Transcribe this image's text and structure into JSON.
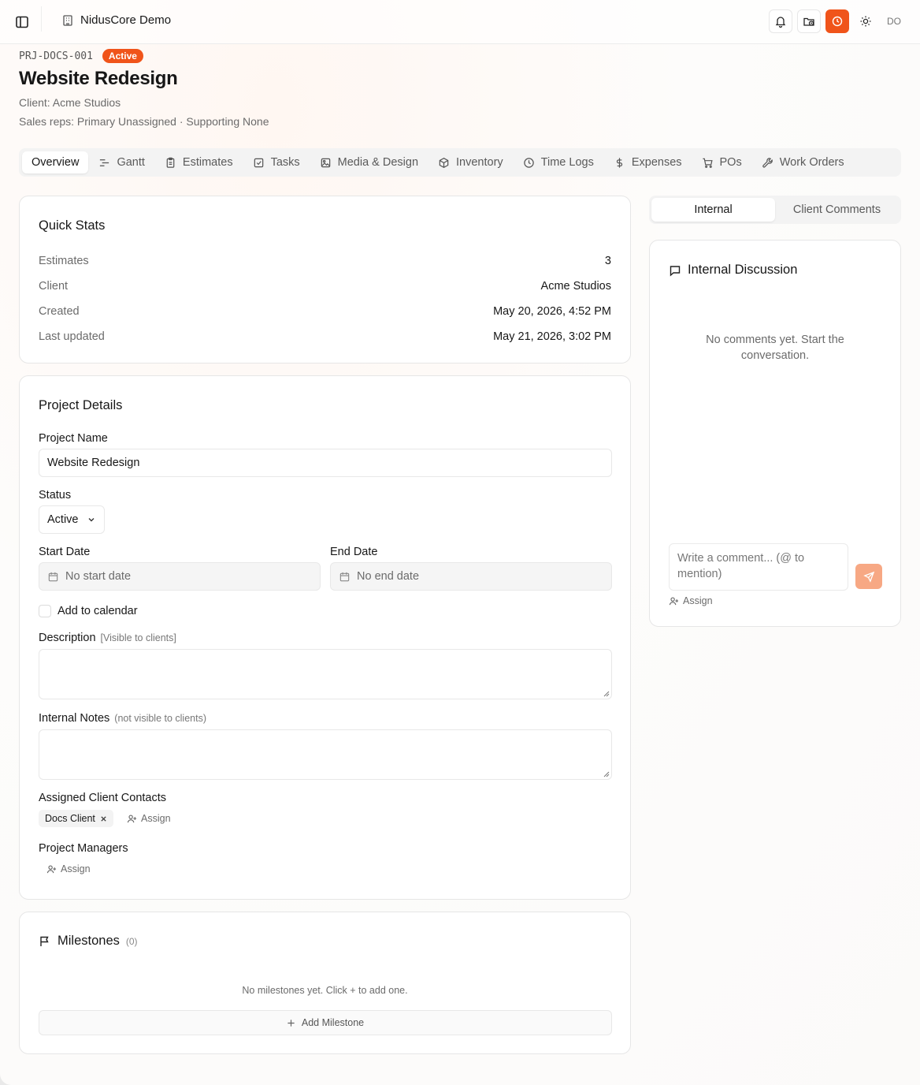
{
  "topbar": {
    "workspace_name": "NidusCore Demo",
    "avatar_initials": "DO",
    "accent_color": "#f0541a"
  },
  "header": {
    "project_code": "PRJ-DOCS-001",
    "status_badge": "Active",
    "title": "Website Redesign",
    "client_line": "Client: Acme Studios",
    "sales_reps_line": "Sales reps: Primary Unassigned · Supporting None"
  },
  "tabs": [
    {
      "label": "Overview",
      "icon": "none",
      "active": true
    },
    {
      "label": "Gantt",
      "icon": "gantt-icon"
    },
    {
      "label": "Estimates",
      "icon": "clipboard-icon"
    },
    {
      "label": "Tasks",
      "icon": "checkbox-icon"
    },
    {
      "label": "Media & Design",
      "icon": "image-icon"
    },
    {
      "label": "Inventory",
      "icon": "package-icon"
    },
    {
      "label": "Time Logs",
      "icon": "clock-icon"
    },
    {
      "label": "Expenses",
      "icon": "dollar-icon"
    },
    {
      "label": "POs",
      "icon": "cart-icon"
    },
    {
      "label": "Work Orders",
      "icon": "wrench-icon"
    }
  ],
  "quick_stats": {
    "title": "Quick Stats",
    "rows": [
      {
        "label": "Estimates",
        "value": "3"
      },
      {
        "label": "Client",
        "value": "Acme Studios"
      },
      {
        "label": "Created",
        "value": "May 20, 2026, 4:52 PM"
      },
      {
        "label": "Last updated",
        "value": "May 21, 2026, 3:02 PM"
      }
    ]
  },
  "project_details": {
    "title": "Project Details",
    "name_label": "Project Name",
    "name_value": "Website Redesign",
    "status_label": "Status",
    "status_value": "Active",
    "start_label": "Start Date",
    "start_placeholder": "No start date",
    "end_label": "End Date",
    "end_placeholder": "No end date",
    "calendar_label": "Add to calendar",
    "description_label": "Description",
    "description_note": "[Visible to clients]",
    "notes_label": "Internal Notes",
    "notes_note": "(not visible to clients)",
    "contacts_label": "Assigned Client Contacts",
    "contact_chip": "Docs Client",
    "assign_label": "Assign",
    "managers_label": "Project Managers"
  },
  "milestones": {
    "title": "Milestones",
    "count": "(0)",
    "empty_text": "No milestones yet. Click + to add one.",
    "add_label": "Add Milestone"
  },
  "discussion": {
    "tab_internal": "Internal",
    "tab_client": "Client Comments",
    "title": "Internal Discussion",
    "empty_text": "No comments yet. Start the conversation.",
    "comment_placeholder": "Write a comment... (@ to mention)",
    "assign_label": "Assign"
  }
}
